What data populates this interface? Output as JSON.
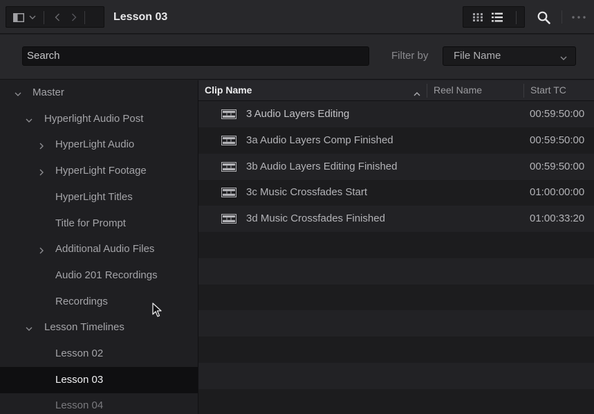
{
  "toolbar": {
    "title": "Lesson 03",
    "icons": [
      "sidebar-toggle-icon",
      "chevron-down-icon",
      "back-icon",
      "forward-icon",
      "thumbnail-view-icon",
      "list-view-icon",
      "search-icon",
      "more-icon"
    ]
  },
  "search": {
    "value": "Search"
  },
  "filter": {
    "label": "Filter by",
    "selected": "File Name"
  },
  "sidebar": {
    "items": [
      {
        "label": "Master",
        "indent": 0,
        "chevron": "down"
      },
      {
        "label": "Hyperlight Audio Post",
        "indent": 1,
        "chevron": "down"
      },
      {
        "label": "HyperLight Audio",
        "indent": 2,
        "chevron": "right"
      },
      {
        "label": "HyperLight Footage",
        "indent": 2,
        "chevron": "right"
      },
      {
        "label": "HyperLight Titles",
        "indent": 2,
        "chevron": "none"
      },
      {
        "label": "Title for Prompt",
        "indent": 2,
        "chevron": "none"
      },
      {
        "label": "Additional Audio Files",
        "indent": 2,
        "chevron": "right"
      },
      {
        "label": "Audio 201 Recordings",
        "indent": 2,
        "chevron": "none"
      },
      {
        "label": "Recordings",
        "indent": 2,
        "chevron": "none"
      },
      {
        "label": "Lesson Timelines",
        "indent": 1,
        "chevron": "down"
      },
      {
        "label": "Lesson 02",
        "indent": 2,
        "chevron": "none"
      },
      {
        "label": "Lesson 03",
        "indent": 2,
        "chevron": "none",
        "selected": true
      },
      {
        "label": "Lesson 04",
        "indent": 2,
        "chevron": "none",
        "dim": true
      }
    ]
  },
  "clip_list": {
    "columns": {
      "clip": "Clip Name",
      "reel": "Reel Name",
      "tc": "Start TC"
    },
    "sort": "ascending",
    "rows": [
      {
        "name": "3 Audio Layers Editing",
        "reel": "",
        "tc": "00:59:50:00"
      },
      {
        "name": "3a Audio Layers Comp Finished",
        "reel": "",
        "tc": "00:59:50:00"
      },
      {
        "name": "3b Audio Layers Editing Finished",
        "reel": "",
        "tc": "00:59:50:00"
      },
      {
        "name": "3c Music Crossfades Start",
        "reel": "",
        "tc": "01:00:00:00"
      },
      {
        "name": "3d Music Crossfades Finished",
        "reel": "",
        "tc": "01:00:33:20"
      }
    ],
    "empty_rows": 7
  },
  "colors": {
    "background": "#1f1f22",
    "toolbar": "#28282b",
    "selected_row": "#0f0f11",
    "text": "#a9a9ad",
    "text_bright": "#ececee"
  }
}
